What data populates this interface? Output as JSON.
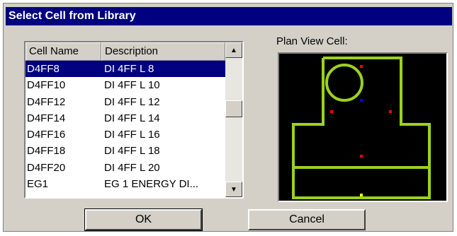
{
  "dialog": {
    "title": "Select Cell from Library"
  },
  "list": {
    "columns": [
      "Cell Name",
      "Description"
    ],
    "rows": [
      {
        "name": "D4FF8",
        "description": "DI 4FF L 8",
        "selected": true
      },
      {
        "name": "D4FF10",
        "description": "DI 4FF L 10",
        "selected": false
      },
      {
        "name": "D4FF12",
        "description": "DI 4FF L 12",
        "selected": false
      },
      {
        "name": "D4FF14",
        "description": "DI 4FF L 14",
        "selected": false
      },
      {
        "name": "D4FF16",
        "description": "DI 4FF L 16",
        "selected": false
      },
      {
        "name": "D4FF18",
        "description": "DI 4FF L 18",
        "selected": false
      },
      {
        "name": "D4FF20",
        "description": "DI 4FF L 20",
        "selected": false
      },
      {
        "name": "EG1",
        "description": "EG 1 ENERGY DI...",
        "selected": false
      }
    ]
  },
  "preview": {
    "label": "Plan View Cell:",
    "colors": {
      "background": "#000000",
      "outline": "#9bd21e",
      "points": "#ff0000",
      "origin": "#0000ff",
      "marker": "#ffff00"
    }
  },
  "buttons": {
    "ok": "OK",
    "cancel": "Cancel"
  },
  "icons": {
    "scroll_up": "triangle-up-icon",
    "scroll_down": "triangle-down-icon"
  }
}
